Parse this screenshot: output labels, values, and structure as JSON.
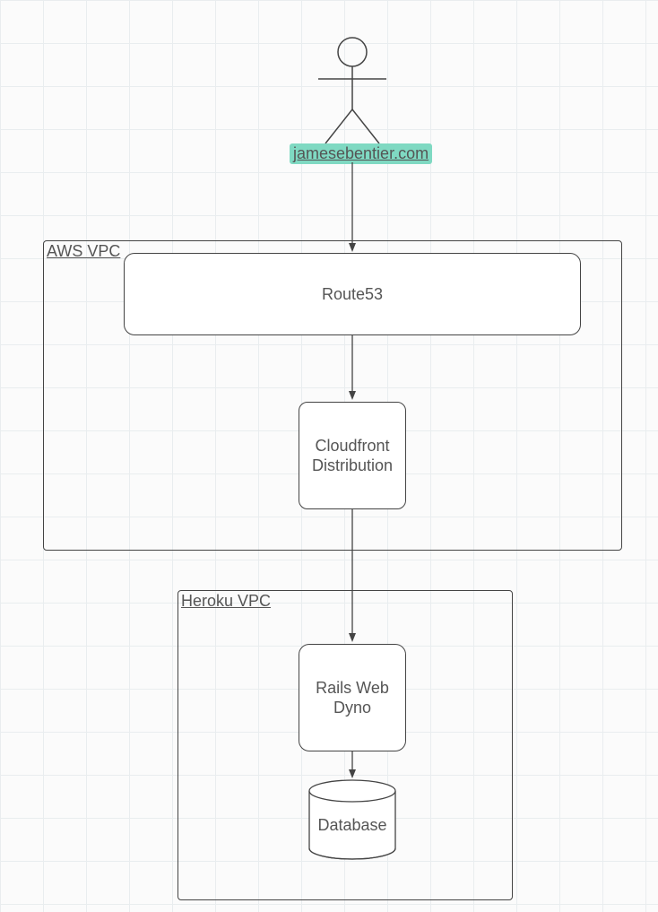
{
  "actor": {
    "label": "jamesebentier.com"
  },
  "containers": {
    "aws": {
      "label": "AWS VPC"
    },
    "heroku": {
      "label": "Heroku VPC"
    }
  },
  "nodes": {
    "route53": {
      "label": "Route53"
    },
    "cloudfront": {
      "label": "Cloudfront\nDistribution"
    },
    "rails": {
      "label": "Rails Web\nDyno"
    },
    "database": {
      "label": "Database"
    }
  },
  "colors": {
    "stroke": "#444444",
    "highlight": "#7fd9c2"
  }
}
